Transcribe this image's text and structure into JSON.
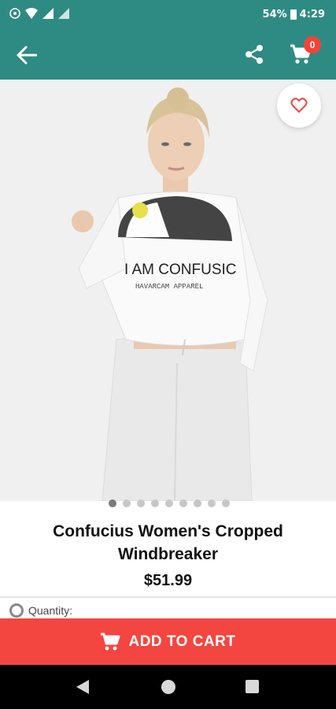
{
  "status_bar": {
    "battery": "54%",
    "time": "4:29"
  },
  "app_bar": {
    "back_icon": "arrow-left-icon",
    "share_icon": "share-icon",
    "cart_icon": "cart-icon",
    "cart_count": "0"
  },
  "product": {
    "image_text_line1": "I AM CONFUSIC",
    "image_text_line2": "HAVARCAM APPAREL",
    "title": "Confucius Women's Cropped Windbreaker",
    "price": "$51.99",
    "carousel": {
      "count": 9,
      "active": 0
    }
  },
  "quantity": {
    "label": "Quantity:"
  },
  "add_to_cart": {
    "label": "ADD TO CART"
  },
  "colors": {
    "primary": "#2e8b83",
    "accent": "#f44640",
    "badge": "#f44336"
  }
}
